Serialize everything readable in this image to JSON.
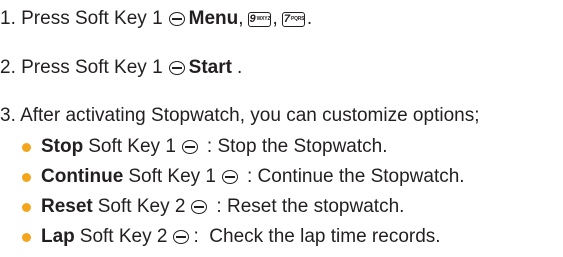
{
  "colors": {
    "text": "#231f20",
    "bullet": "#f3a51b"
  },
  "icons": {
    "soft_key": "soft-key-icon",
    "keypad_9": "keypad-9-key-icon",
    "keypad_7": "keypad-7-key-icon"
  },
  "step1": {
    "text": "1. Press Soft Key 1",
    "bold": "Menu",
    "sep1": ",",
    "key9_digit": "9",
    "key9_letters": "WXYZ",
    "sep2": ",",
    "key7_digit": "7",
    "key7_letters": "PQRS",
    "end": "."
  },
  "step2": {
    "text": "2. Press Soft Key 1",
    "bold": "Start",
    "end": "."
  },
  "step3": {
    "text": "3. After activating Stopwatch, you can customize options;"
  },
  "options": [
    {
      "bold": "Stop",
      "key": "Soft Key 1",
      "desc": ": Stop the Stopwatch."
    },
    {
      "bold": "Continue",
      "key": "Soft Key 1",
      "desc": ": Continue the Stopwatch."
    },
    {
      "bold": "Reset",
      "key": "Soft Key 2",
      "desc": ": Reset the stopwatch."
    },
    {
      "bold": "Lap",
      "key": "Soft Key 2",
      "desc": ":  Check the lap time records."
    }
  ]
}
